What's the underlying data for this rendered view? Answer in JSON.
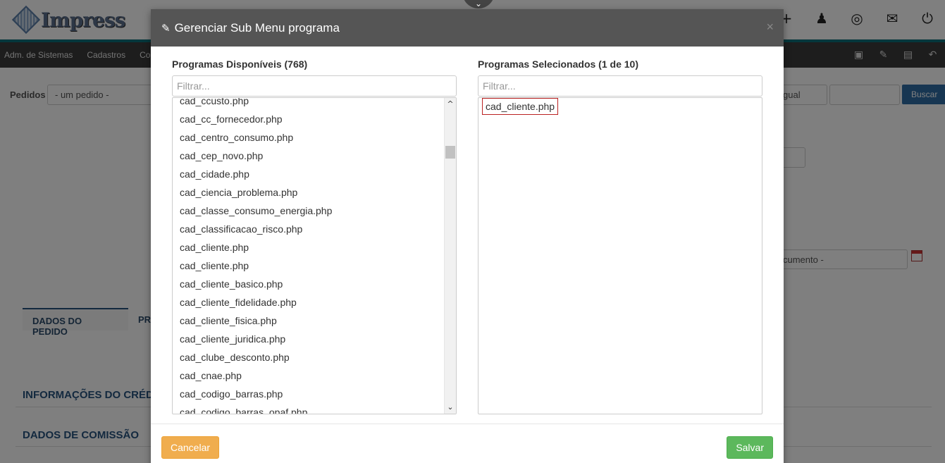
{
  "app": {
    "logo_text": "Impress",
    "nav": [
      "Adm. de Sistemas",
      "Cadastros",
      "Com"
    ],
    "top_icons": [
      "plus-icon",
      "user-icon",
      "lifebuoy-icon",
      "envelope-icon",
      "power-icon"
    ],
    "nav_tools": [
      "save-icon",
      "eraser-icon",
      "keyboard-icon",
      "undo-icon"
    ],
    "pedidos_label": "Pedidos",
    "pedidos_select": "- um pedido -",
    "compare_select": "gual",
    "search_button": "Buscar",
    "doc_select": "cumento -",
    "tab_dados": "DADOS DO PEDIDO",
    "tab_next": "PR",
    "section_credito": "INFORMAÇÕES DO CRÉD",
    "section_comissao": "DADOS DE COMISSÃO"
  },
  "modal": {
    "title": "Gerenciar Sub Menu programa",
    "close": "×",
    "available": {
      "title": "Programas Disponíveis (768)",
      "filter_placeholder": "Filtrar...",
      "items": [
        "cad_ccusto.php",
        "cad_cc_fornecedor.php",
        "cad_centro_consumo.php",
        "cad_cep_novo.php",
        "cad_cidade.php",
        "cad_ciencia_problema.php",
        "cad_classe_consumo_energia.php",
        "cad_classificacao_risco.php",
        "cad_cliente.php",
        "cad_cliente.php",
        "cad_cliente_basico.php",
        "cad_cliente_fidelidade.php",
        "cad_cliente_fisica.php",
        "cad_cliente_juridica.php",
        "cad_clube_desconto.php",
        "cad_cnae.php",
        "cad_codigo_barras.php",
        "cad_codigo_barras_opaf.php"
      ]
    },
    "selected": {
      "title": "Programas Selecionados (1 de 10)",
      "filter_placeholder": "Filtrar...",
      "items": [
        "cad_cliente.php"
      ]
    },
    "cancel_label": "Cancelar",
    "save_label": "Salvar"
  },
  "colors": {
    "header": "#555555",
    "cancel": "#f0ad4e",
    "save": "#5cb85c",
    "navbar": "#3a3a3a",
    "accent_stripe": "#0a6e78"
  }
}
